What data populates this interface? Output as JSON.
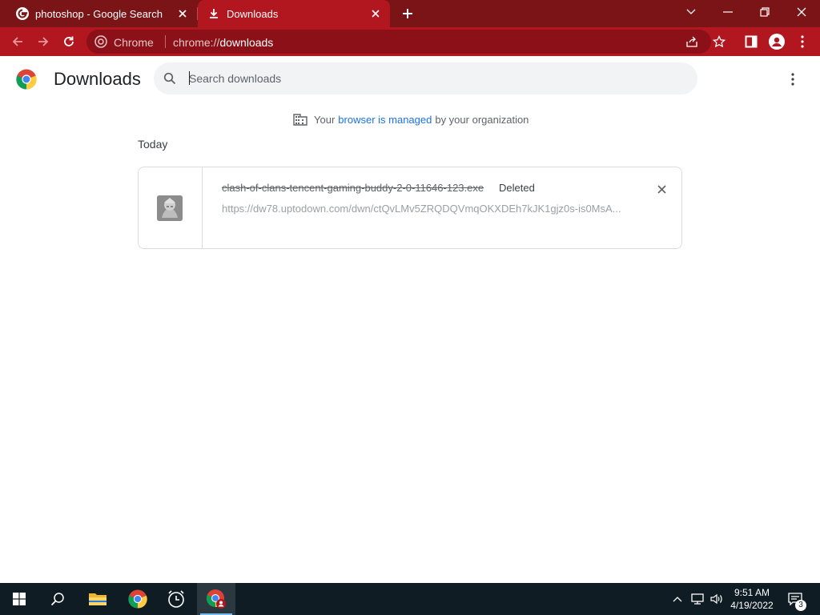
{
  "browser": {
    "tabs": [
      {
        "title": "photoshop - Google Search",
        "icon": "google-g-icon",
        "active": false
      },
      {
        "title": "Downloads",
        "icon": "download-icon",
        "active": true
      }
    ],
    "omnibox": {
      "chip": "Chrome",
      "url_scheme": "chrome://",
      "url_host": "downloads"
    },
    "colors": {
      "frame": "#7a1416",
      "toolbar": "#b2161f",
      "omnibox": "#8c1018"
    }
  },
  "page": {
    "title": "Downloads",
    "search": {
      "placeholder": "Search downloads",
      "value": ""
    },
    "managed_notice": {
      "prefix": "Your",
      "link": "browser is managed",
      "suffix": "by your organization"
    },
    "sections": [
      {
        "date": "Today",
        "items": [
          {
            "file_name": "clash-of-clans-tencent-gaming-buddy-2-0-11646-123.exe",
            "status": "Deleted",
            "url": "https://dw78.uptodown.com/dwn/ctQvLMv5ZRQDQVmqOKXDEh7kJK1gjz0s-is0MsA..."
          }
        ]
      }
    ]
  },
  "taskbar": {
    "pinned": [
      "windows-start-icon",
      "search-icon",
      "file-explorer-icon",
      "chrome-icon",
      "alarms-clock-icon",
      "chrome-profile-icon"
    ],
    "clock": {
      "time": "9:51 AM",
      "date": "4/19/2022"
    },
    "notifications_count": "3"
  }
}
